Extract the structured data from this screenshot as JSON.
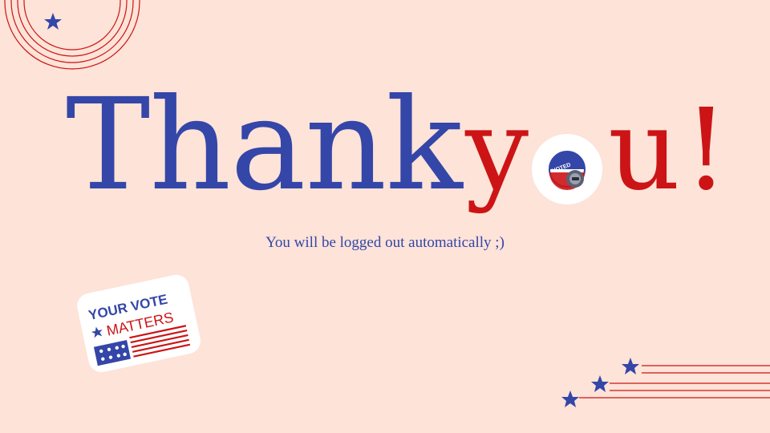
{
  "title": {
    "word1": "Thank",
    "word2_y": "y",
    "word2_rest": "u!"
  },
  "subtitle": "You will be logged out automatically ;)",
  "voted_badge": {
    "text": "VOTED"
  },
  "sticker": {
    "line1": "YOUR VOTE",
    "line2": "MATTERS"
  },
  "colors": {
    "background": "#fde3d8",
    "blue": "#3446a8",
    "red": "#cc1416",
    "white": "#ffffff"
  },
  "icons": [
    "concentric-rings-decoration",
    "star-icon",
    "voted-badge-icon",
    "your-vote-matters-sticker",
    "stars-with-lines-decoration"
  ]
}
